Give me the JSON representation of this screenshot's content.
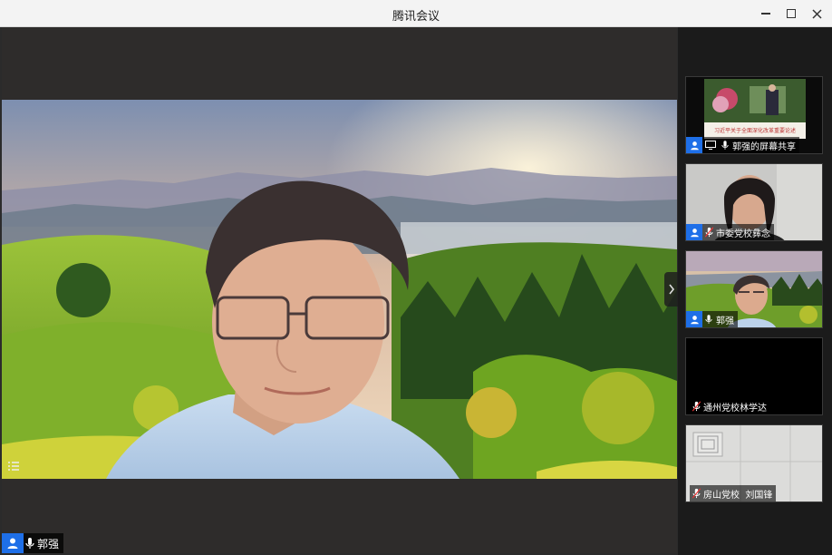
{
  "window": {
    "title": "腾讯会议"
  },
  "main": {
    "speaker_name": "郭强"
  },
  "participants": [
    {
      "name": "郭强的屏幕共享",
      "type": "screen-share",
      "slide_caption": "习近平关于全面深化改革重要论述"
    },
    {
      "name": "市委党校彝念",
      "type": "camera"
    },
    {
      "name": "郭强",
      "type": "camera"
    },
    {
      "name": "通州党校林学达",
      "type": "off"
    },
    {
      "name": "房山党校  刘国锋",
      "type": "camera"
    }
  ],
  "colors": {
    "accent": "#1e6fe8",
    "titlebar": "#f3f3f3",
    "stage_bg": "#2e2c2b",
    "sidebar_bg": "#1b1b1b"
  },
  "icons": [
    "user-icon",
    "mic-icon",
    "mic-muted-icon",
    "screen-share-icon",
    "chevron-right-icon",
    "list-icon"
  ]
}
